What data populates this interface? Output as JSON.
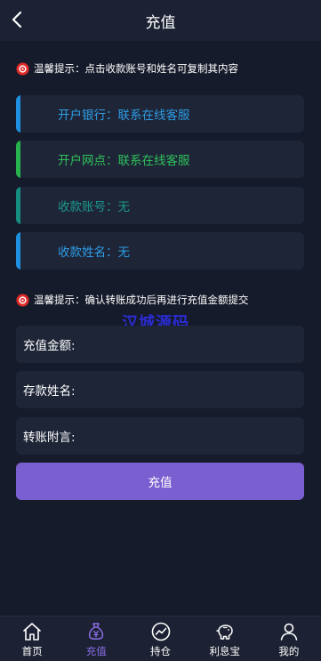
{
  "header": {
    "title": "充值"
  },
  "tips": [
    "温馨提示：点击收款账号和姓名可复制其内容",
    "温馨提示：确认转账成功后再进行充值金额提交"
  ],
  "info": [
    {
      "text": "开户银行：联系在线客服",
      "color": "#2e9de6",
      "bar": "#1f8fe0"
    },
    {
      "text": "开户网点：联系在线客服",
      "color": "#2fc15a",
      "bar": "#27b24e"
    },
    {
      "text": "收款账号：无",
      "color": "#1b9a8e",
      "bar": "#178d82"
    },
    {
      "text": "收款姓名：无",
      "color": "#2e9de6",
      "bar": "#1f8fe0"
    }
  ],
  "form": {
    "amount_label": "充值金额:",
    "name_label": "存款姓名:",
    "note_label": "转账附言:",
    "amount_value": "",
    "name_value": "",
    "note_value": ""
  },
  "submit_label": "充值",
  "watermark": "汉城源码",
  "tabs": [
    {
      "label": "首页",
      "icon": "home-icon",
      "active": false
    },
    {
      "label": "充值",
      "icon": "money-bag-icon",
      "active": true
    },
    {
      "label": "持仓",
      "icon": "chart-circle-icon",
      "active": false
    },
    {
      "label": "利息宝",
      "icon": "piggy-bank-icon",
      "active": false
    },
    {
      "label": "我的",
      "icon": "user-icon",
      "active": false
    }
  ],
  "colors": {
    "accent": "#7a5fd0",
    "active_tab": "#8c6de6",
    "tip_icon": "#e02a2a"
  }
}
